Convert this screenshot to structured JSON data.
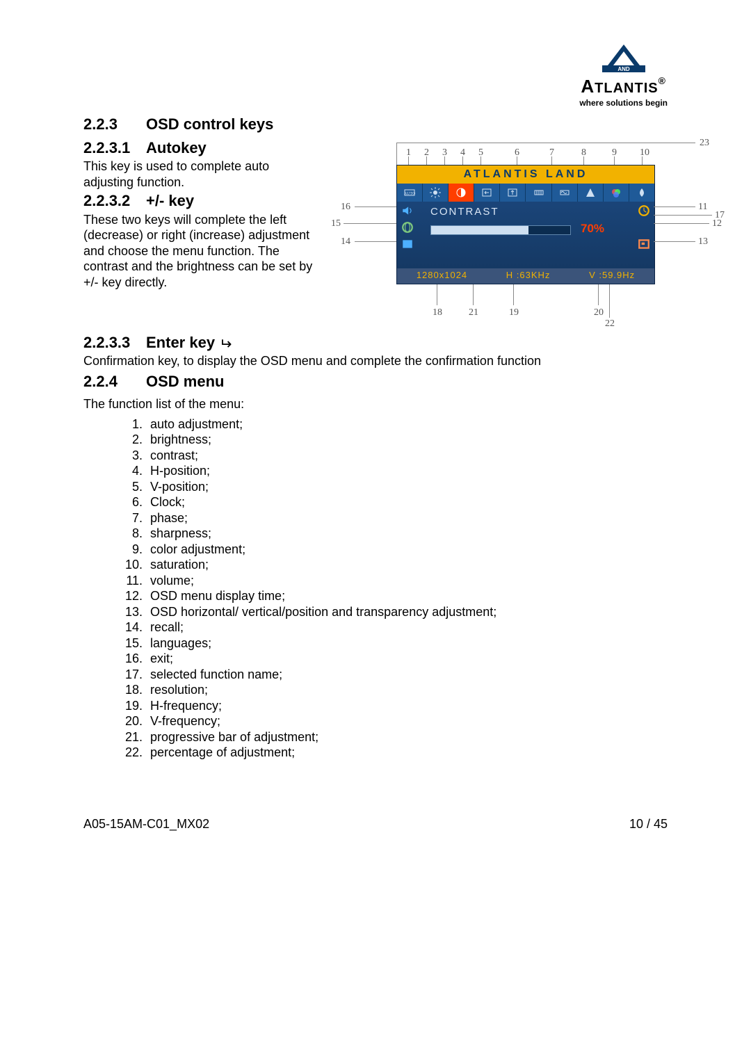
{
  "logo": {
    "name": "TLANTIS",
    "and": "AND",
    "tagline": "where solutions begin"
  },
  "sec223": {
    "num": "2.2.3",
    "title": "OSD control keys"
  },
  "sec2231": {
    "num": "2.2.3.1",
    "title": "Autokey",
    "body": "This key is used to complete auto adjusting function."
  },
  "sec2232": {
    "num": "2.2.3.2",
    "title": "+/- key",
    "body": "These two keys will complete the left (decrease) or right (increase) adjustment and choose the menu function. The contrast and the brightness can be set by +/- key directly."
  },
  "sec2233": {
    "num": "2.2.3.3",
    "title": "Enter key",
    "body": "Confirmation key, to display the OSD menu and complete the confirmation function"
  },
  "sec224": {
    "num": "2.2.4",
    "title": "OSD menu",
    "intro": "The function list of the menu:"
  },
  "menu_items": [
    "auto adjustment;",
    "brightness;",
    "contrast;",
    "H-position;",
    "V-position;",
    "Clock;",
    "phase;",
    "sharpness;",
    "color adjustment;",
    "saturation;",
    "volume;",
    "OSD menu display time;",
    "OSD horizontal/ vertical/position and transparency adjustment;",
    "recall;",
    "languages;",
    "exit;",
    "selected function name;",
    "resolution;",
    "H-frequency;",
    "V-frequency;",
    "progressive bar of adjustment;",
    "percentage of adjustment;"
  ],
  "osd": {
    "title": "ATLANTIS LAND",
    "contrast_label": "CONTRAST",
    "percent": "70%",
    "resolution": "1280x1024",
    "hfreq": "H :63KHz",
    "vfreq": "V :59.9Hz"
  },
  "callouts": {
    "c1": "1",
    "c2": "2",
    "c3": "3",
    "c4": "4",
    "c5": "5",
    "c6": "6",
    "c7": "7",
    "c8": "8",
    "c9": "9",
    "c10": "10",
    "c11": "11",
    "c12": "12",
    "c13": "13",
    "c14": "14",
    "c15": "15",
    "c16": "16",
    "c17": "17",
    "c18": "18",
    "c19": "19",
    "c20": "20",
    "c21": "21",
    "c22": "22",
    "c23": "23"
  },
  "footer": {
    "docid": "A05-15AM-C01_MX02",
    "page": "10 / 45"
  }
}
